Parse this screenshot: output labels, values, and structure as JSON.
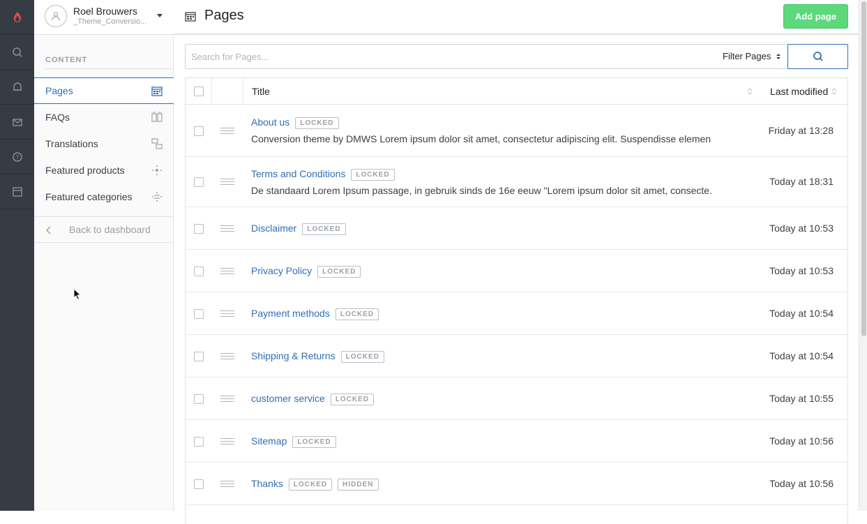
{
  "account": {
    "name": "Roel Brouwers",
    "store": "_Theme_Conversio..."
  },
  "rail": [
    "logo-icon",
    "search-icon",
    "notification-icon",
    "mail-icon",
    "help-icon",
    "store-icon"
  ],
  "sidebar": {
    "section_title": "CONTENT",
    "items": [
      {
        "label": "Pages",
        "icon": "pages-icon",
        "active": true
      },
      {
        "label": "FAQs",
        "icon": "faq-icon",
        "active": false
      },
      {
        "label": "Translations",
        "icon": "translations-icon",
        "active": false
      },
      {
        "label": "Featured products",
        "icon": "featured-products-icon",
        "active": false
      },
      {
        "label": "Featured categories",
        "icon": "featured-categories-icon",
        "active": false
      }
    ],
    "back_label": "Back to dashboard"
  },
  "header": {
    "title": "Pages",
    "add_button": "Add page"
  },
  "search": {
    "placeholder": "Search for Pages...",
    "filter_label": "Filter Pages"
  },
  "table": {
    "columns": {
      "title": "Title",
      "modified": "Last modified"
    },
    "rows": [
      {
        "title": "About us",
        "badges": [
          "LOCKED"
        ],
        "desc": "Conversion theme by DMWS Lorem ipsum dolor sit amet, consectetur adipiscing elit. Suspendisse elemen...",
        "modified": "Friday at 13:28"
      },
      {
        "title": "Terms and Conditions",
        "badges": [
          "LOCKED"
        ],
        "desc": "De standaard Lorem Ipsum passage, in gebruik sinds de 16e eeuw \"Lorem ipsum dolor sit amet, consecte...",
        "modified": "Today at 18:31"
      },
      {
        "title": "Disclaimer",
        "badges": [
          "LOCKED"
        ],
        "desc": "",
        "modified": "Today at 10:53"
      },
      {
        "title": "Privacy Policy",
        "badges": [
          "LOCKED"
        ],
        "desc": "",
        "modified": "Today at 10:53"
      },
      {
        "title": "Payment methods",
        "badges": [
          "LOCKED"
        ],
        "desc": "",
        "modified": "Today at 10:54"
      },
      {
        "title": "Shipping & Returns",
        "badges": [
          "LOCKED"
        ],
        "desc": "",
        "modified": "Today at 10:54"
      },
      {
        "title": "customer service",
        "badges": [
          "LOCKED"
        ],
        "desc": "",
        "modified": "Today at 10:55"
      },
      {
        "title": "Sitemap",
        "badges": [
          "LOCKED"
        ],
        "desc": "",
        "modified": "Today at 10:56"
      },
      {
        "title": "Thanks",
        "badges": [
          "LOCKED",
          "HIDDEN"
        ],
        "desc": "",
        "modified": "Today at 10:56"
      }
    ]
  },
  "colors": {
    "rail": "#363c43",
    "accent": "#2e6fb5",
    "add_button": "#5cd97a",
    "logo": "#e2504a"
  }
}
